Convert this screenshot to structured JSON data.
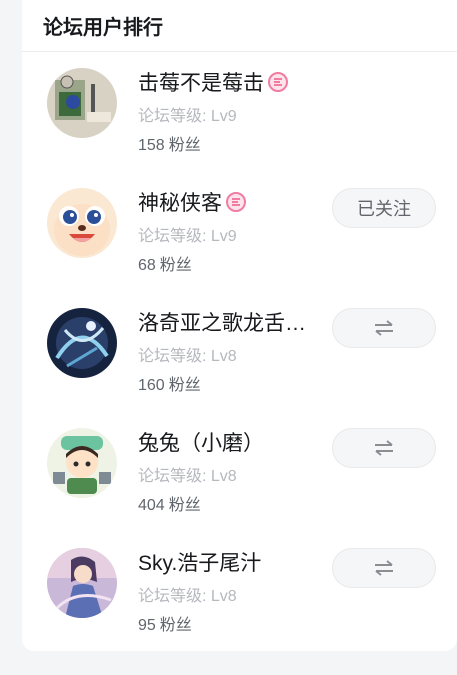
{
  "header": {
    "title": "论坛用户排行"
  },
  "labels": {
    "level_prefix": "论坛等级: ",
    "fans_suffix": "粉丝"
  },
  "colors": {
    "badge": "#f07ca2",
    "text": "#18191c",
    "muted": "#b5b8be"
  },
  "users": [
    {
      "name": "击莓不是莓击",
      "level": "Lv9",
      "fans": "158",
      "badge": "creator-badge-icon",
      "action": "none"
    },
    {
      "name": "神秘侠客",
      "level": "Lv9",
      "fans": "68",
      "badge": "creator-badge-icon",
      "action": "followed",
      "action_label": "已关注"
    },
    {
      "name": "洛奇亚之歌龙舌…",
      "level": "Lv8",
      "fans": "160",
      "action": "swap",
      "action_icon": "swap-arrows-icon"
    },
    {
      "name": "兔兔（小磨）",
      "level": "Lv8",
      "fans": "404",
      "action": "swap",
      "action_icon": "swap-arrows-icon"
    },
    {
      "name": "Sky.浩子尾汁",
      "level": "Lv8",
      "fans": "95",
      "action": "swap",
      "action_icon": "swap-arrows-icon"
    }
  ]
}
